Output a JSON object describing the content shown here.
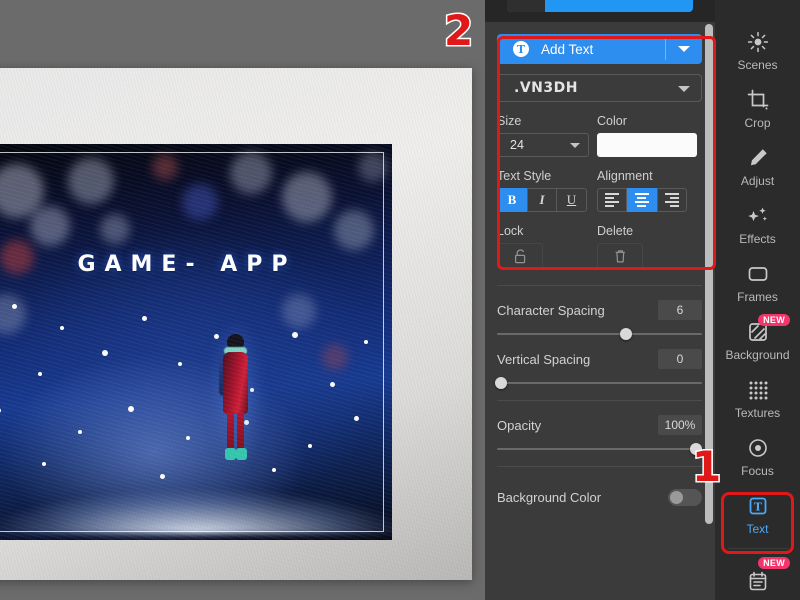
{
  "canvas": {
    "photo_title": "GAME- APP",
    "scene_description": "winter-night-snow-photo"
  },
  "panel": {
    "add_text": {
      "label": "Add Text",
      "icon": "text-circle-icon",
      "caret": "chevron-down-icon",
      "accent": "#2d8ef0"
    },
    "font": {
      "selected": ".VN3DH",
      "caret": "chevron-down-icon"
    },
    "size": {
      "label": "Size",
      "value": "24"
    },
    "color": {
      "label": "Color",
      "value": "#fbfbfb"
    },
    "text_style": {
      "label": "Text Style",
      "buttons": [
        {
          "name": "bold",
          "glyph": "B",
          "active": true
        },
        {
          "name": "italic",
          "glyph": "I",
          "active": false
        },
        {
          "name": "underline",
          "glyph": "U",
          "active": false
        }
      ]
    },
    "alignment": {
      "label": "Alignment",
      "buttons": [
        {
          "name": "align-left",
          "active": false
        },
        {
          "name": "align-center",
          "active": true
        },
        {
          "name": "align-right",
          "active": false
        }
      ]
    },
    "lock": {
      "label": "Lock",
      "icon": "padlock-icon",
      "enabled": false
    },
    "delete": {
      "label": "Delete",
      "icon": "trash-icon",
      "enabled": false
    },
    "sliders": [
      {
        "name": "Character Spacing",
        "value": "6",
        "percent": 63
      },
      {
        "name": "Vertical Spacing",
        "value": "0",
        "percent": 0
      },
      {
        "name": "Opacity",
        "value": "100%",
        "percent": 97
      }
    ],
    "background_color": {
      "label": "Background Color",
      "on": false
    }
  },
  "toolbar": {
    "items": [
      {
        "label": "Scenes",
        "icon": "sun-scenes-icon",
        "active": false,
        "badge": ""
      },
      {
        "label": "Crop",
        "icon": "crop-icon",
        "active": false,
        "badge": ""
      },
      {
        "label": "Adjust",
        "icon": "pencil-icon",
        "active": false,
        "badge": ""
      },
      {
        "label": "Effects",
        "icon": "sparkles-icon",
        "active": false,
        "badge": ""
      },
      {
        "label": "Frames",
        "icon": "frame-icon",
        "active": false,
        "badge": ""
      },
      {
        "label": "Background",
        "icon": "hatched-square-icon",
        "active": false,
        "badge": "NEW"
      },
      {
        "label": "Textures",
        "icon": "dot-grid-icon",
        "active": false,
        "badge": ""
      },
      {
        "label": "Focus",
        "icon": "target-circle-icon",
        "active": false,
        "badge": ""
      },
      {
        "label": "Text",
        "icon": "text-box-icon",
        "active": true,
        "badge": ""
      },
      {
        "label": "",
        "icon": "calendar-icon",
        "active": false,
        "badge": "NEW"
      }
    ]
  },
  "annotations": [
    {
      "number": "1",
      "target": "text-tool"
    },
    {
      "number": "2",
      "target": "text-options-panel"
    }
  ]
}
